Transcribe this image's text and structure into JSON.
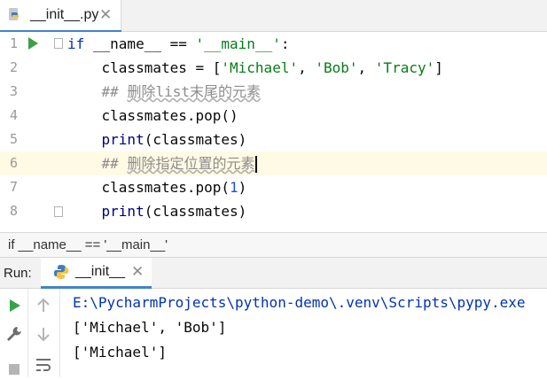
{
  "tab": {
    "filename": "__init__.py",
    "close": "✕"
  },
  "editor": {
    "lines": [
      {
        "num": "1"
      },
      {
        "num": "2"
      },
      {
        "num": "3"
      },
      {
        "num": "4"
      },
      {
        "num": "5"
      },
      {
        "num": "6"
      },
      {
        "num": "7"
      },
      {
        "num": "8"
      }
    ],
    "code": {
      "l1_if": "if",
      "l1_name": " __name__ == ",
      "l1_str": "'__main__'",
      "l1_colon": ":",
      "l2_pre": "    classmates = [",
      "l2_s1": "'Michael'",
      "l2_sep1": ", ",
      "l2_s2": "'Bob'",
      "l2_sep2": ", ",
      "l2_s3": "'Tracy'",
      "l2_end": "]",
      "l3_hash": "    ## ",
      "l3_text": "删除list末尾的元素",
      "l4": "    classmates.pop()",
      "l5_print": "print",
      "l5_rest": "(classmates)",
      "l6_hash": "    ## ",
      "l6_text": "删除指定位置的元素",
      "l7_pre": "    classmates.pop(",
      "l7_num": "1",
      "l7_end": ")",
      "l8_print": "print",
      "l8_rest": "(classmates)"
    }
  },
  "breadcrumb": {
    "text": "if __name__ == '__main__'"
  },
  "run": {
    "label": "Run:",
    "tab_name": "__init__",
    "close": "✕",
    "output": [
      "E:\\PycharmProjects\\python-demo\\.venv\\Scripts\\pypy.exe",
      "['Michael', 'Bob']",
      "['Michael']"
    ]
  },
  "colors": {
    "accent": "#4083c9",
    "run_green": "#3aa14a",
    "active_line": "#fffae3"
  }
}
